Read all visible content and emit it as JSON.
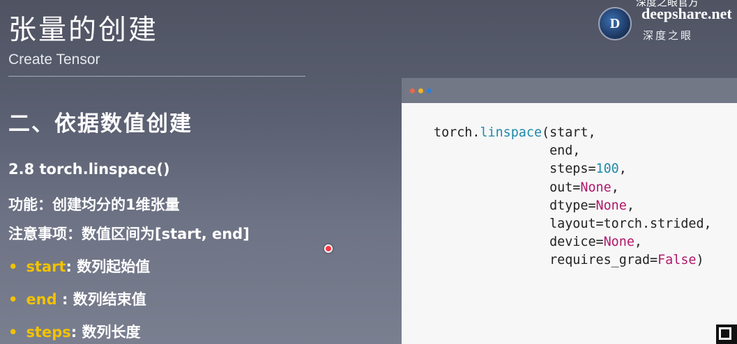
{
  "slide": {
    "title": "张量的创建",
    "subtitle": "Create Tensor",
    "section_heading": "二、依据数值创建",
    "function_heading": "2.8 torch.linspace()",
    "feature_line": "功能：创建均分的1维张量",
    "note_line": "注意事项：数值区间为[start, end]",
    "bullets": [
      {
        "marker": "•",
        "key": "start",
        "desc": ": 数列起始值"
      },
      {
        "marker": "•",
        "key": "end",
        "desc": " : 数列结束值"
      },
      {
        "marker": "•",
        "key": "steps",
        "desc": ": 数列长度"
      }
    ]
  },
  "brand": {
    "logo_letter": "D",
    "top_text": "深度之眼官方",
    "name": "deepshare.net",
    "cn": "深度之眼"
  },
  "code_window": {
    "dots": [
      "#e86a4a",
      "#f0b429",
      "#2f7fd0"
    ],
    "lines": [
      {
        "prefix": "torch.",
        "fn": "linspace",
        "rest": "(start,"
      },
      {
        "indent": "               ",
        "param": "end,"
      },
      {
        "indent": "               ",
        "param": "steps=",
        "num": "100",
        "tail": ","
      },
      {
        "indent": "               ",
        "param": "out=",
        "kw": "None",
        "tail": ","
      },
      {
        "indent": "               ",
        "param": "dtype=",
        "kw": "None",
        "tail": ","
      },
      {
        "indent": "               ",
        "param": "layout=torch.strided,"
      },
      {
        "indent": "               ",
        "param": "device=",
        "kw": "None",
        "tail": ","
      },
      {
        "indent": "               ",
        "param": "requires_grad=",
        "kw": "False",
        "tail": ")"
      }
    ]
  },
  "colors": {
    "accent_yellow": "#f2c200",
    "code_function": "#1f8aa8",
    "code_keyword": "#b0196a"
  }
}
